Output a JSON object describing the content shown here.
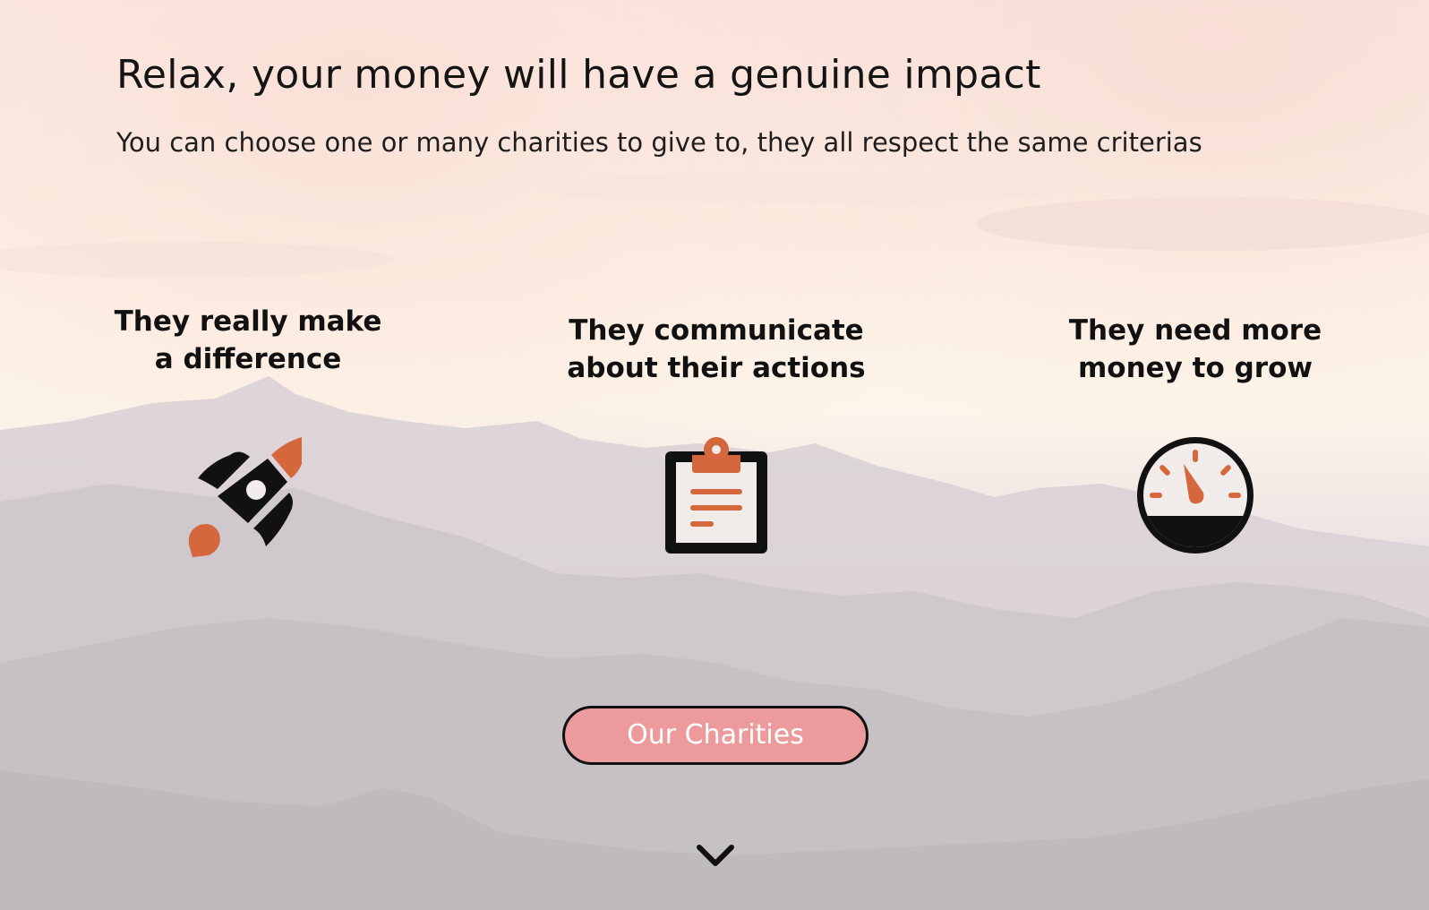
{
  "hero": {
    "title": "Relax, your money will have a genuine impact",
    "subtitle": "You can choose one or many charities to give to, they all respect the same criterias"
  },
  "features": [
    {
      "line1": "They really make",
      "line2": "a difference",
      "icon": "rocket-icon"
    },
    {
      "line1": "They communicate",
      "line2": "about their actions",
      "icon": "clipboard-icon"
    },
    {
      "line1": "They need more",
      "line2": "money to grow",
      "icon": "gauge-icon"
    }
  ],
  "cta": {
    "label": "Our Charities"
  },
  "scroll": {
    "icon": "chevron-down-icon"
  },
  "colors": {
    "accent": "#d4683c",
    "button": "#ec9a9b",
    "text": "#111111"
  }
}
